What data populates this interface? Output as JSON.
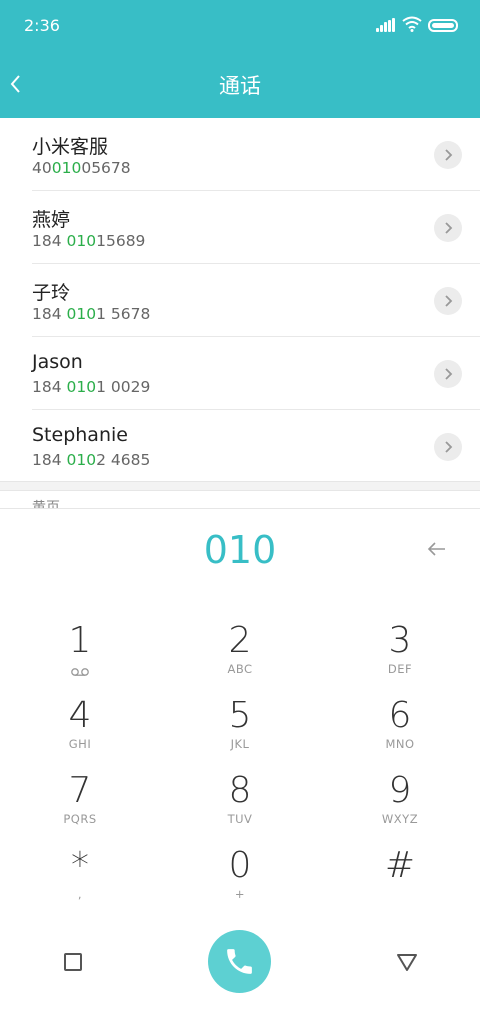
{
  "status": {
    "time": "2:36"
  },
  "header": {
    "title": "通话"
  },
  "contacts": [
    {
      "name": "小米客服",
      "num_pre": "40",
      "num_hl": "010",
      "num_post": "05678"
    },
    {
      "name": "燕婷",
      "num_pre": "184 ",
      "num_hl": "010",
      "num_post": "15689"
    },
    {
      "name": "子玲",
      "num_pre": "184 ",
      "num_hl": "010",
      "num_post": "1 5678"
    },
    {
      "name": "Jason",
      "num_pre": "184 ",
      "num_hl": "010",
      "num_post": "1 0029"
    },
    {
      "name": "Stephanie",
      "num_pre": "184 ",
      "num_hl": "010",
      "num_post": "2 4685"
    }
  ],
  "section_peek": "黄页",
  "dialer": {
    "number": "010",
    "keys": [
      {
        "digit": "1",
        "letters": ""
      },
      {
        "digit": "2",
        "letters": "ABC"
      },
      {
        "digit": "3",
        "letters": "DEF"
      },
      {
        "digit": "4",
        "letters": "GHI"
      },
      {
        "digit": "5",
        "letters": "JKL"
      },
      {
        "digit": "6",
        "letters": "MNO"
      },
      {
        "digit": "7",
        "letters": "PQRS"
      },
      {
        "digit": "8",
        "letters": "TUV"
      },
      {
        "digit": "9",
        "letters": "WXYZ"
      },
      {
        "digit": "*",
        "letters": ","
      },
      {
        "digit": "0",
        "letters": "+"
      },
      {
        "digit": "#",
        "letters": ""
      }
    ]
  },
  "icons": {
    "back": "chevron-left-icon",
    "backspace": "arrow-left-icon",
    "voicemail": "voicemail-icon",
    "call": "phone-icon",
    "recents": "square-icon",
    "nav_back": "triangle-icon"
  },
  "colors": {
    "accent": "#38bec6",
    "match": "#2bae4a",
    "call_button": "#5dd0d2"
  }
}
